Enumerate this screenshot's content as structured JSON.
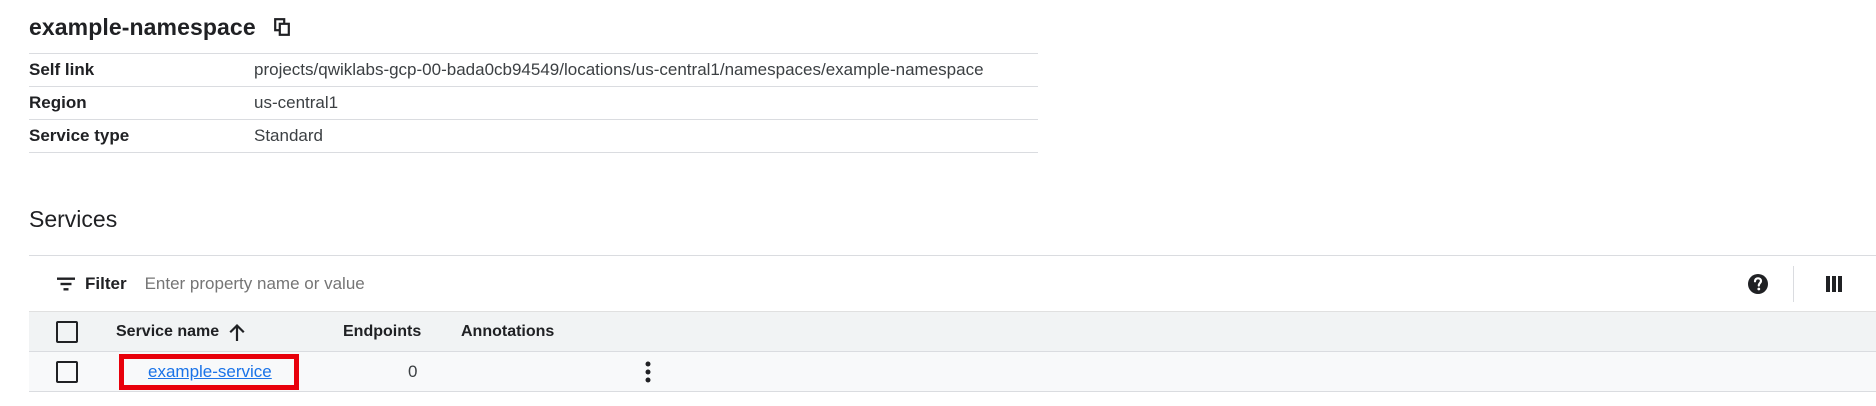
{
  "header": {
    "title": "example-namespace",
    "copy_icon": "copy-icon"
  },
  "details": [
    {
      "key": "Self link",
      "value": "projects/qwiklabs-gcp-00-bada0cb94549/locations/us-central1/namespaces/example-namespace"
    },
    {
      "key": "Region",
      "value": "us-central1"
    },
    {
      "key": "Service type",
      "value": "Standard"
    }
  ],
  "services": {
    "title": "Services",
    "filter": {
      "label": "Filter",
      "placeholder": "Enter property name or value",
      "icon": "filter-icon"
    },
    "toolbar_icons": [
      "help-icon",
      "column-display-options-icon"
    ],
    "columns": {
      "name": "Service name",
      "endpoints": "Endpoints",
      "annotations": "Annotations",
      "sort": "arrow-up-icon"
    },
    "rows": [
      {
        "name": "example-service",
        "endpoints": "0",
        "annotations": ""
      }
    ],
    "highlight_color": "#e8000b",
    "link_color": "#1a73e8"
  }
}
